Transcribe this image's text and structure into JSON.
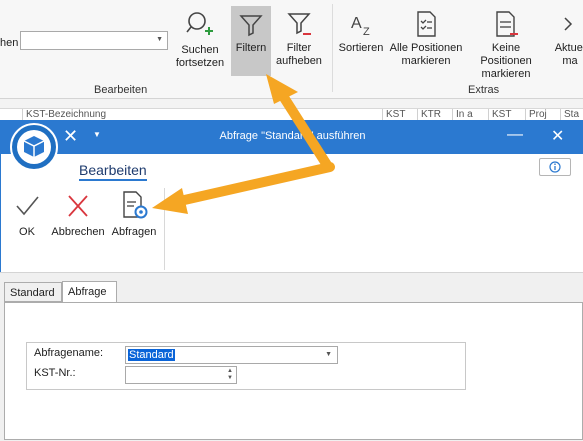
{
  "main_ribbon": {
    "search_label": "hen",
    "search_value": "",
    "buttons": [
      {
        "id": "suchen",
        "label": "Suchen\nfortsetzen",
        "icon": "search-plus-icon"
      },
      {
        "id": "filtern",
        "label": "Filtern",
        "icon": "filter-icon",
        "active": true
      },
      {
        "id": "filter_aufheben",
        "label": "Filter\naufheben",
        "icon": "filter-remove-icon"
      },
      {
        "id": "sortieren",
        "label": "Sortieren",
        "icon": "sort-az-icon"
      },
      {
        "id": "alle_markieren",
        "label": "Alle Positionen\nmarkieren",
        "icon": "select-all-icon"
      },
      {
        "id": "keine_markieren",
        "label": "Keine Positionen\nmarkieren",
        "icon": "select-none-icon"
      },
      {
        "id": "aktuelle",
        "label": "Aktuel\nma",
        "icon": "chevron-icon"
      }
    ],
    "groups": {
      "bearbeiten": "Bearbeiten",
      "extras": "Extras"
    }
  },
  "grid_header": [
    "KST-Bezeichnung",
    "KST",
    "KTR",
    "In a",
    "KST",
    "Proj",
    "Sta"
  ],
  "dialog": {
    "title": "Abfrage \"Standard\" ausführen",
    "tab_label": "Bearbeiten",
    "buttons": {
      "ok": "OK",
      "abbrechen": "Abbrechen",
      "abfragen": "Abfragen"
    },
    "tabs": [
      "Standard",
      "Abfrage"
    ],
    "active_tab": "Abfrage",
    "fields": {
      "abfragename_label": "Abfragename:",
      "abfragename_value": "Standard",
      "kst_label": "KST-Nr.:",
      "kst_value": ""
    }
  },
  "colors": {
    "titlebar": "#2b79d0",
    "arrow": "#f5a623",
    "selection": "#0a64d8",
    "cancel": "#d9363e"
  }
}
